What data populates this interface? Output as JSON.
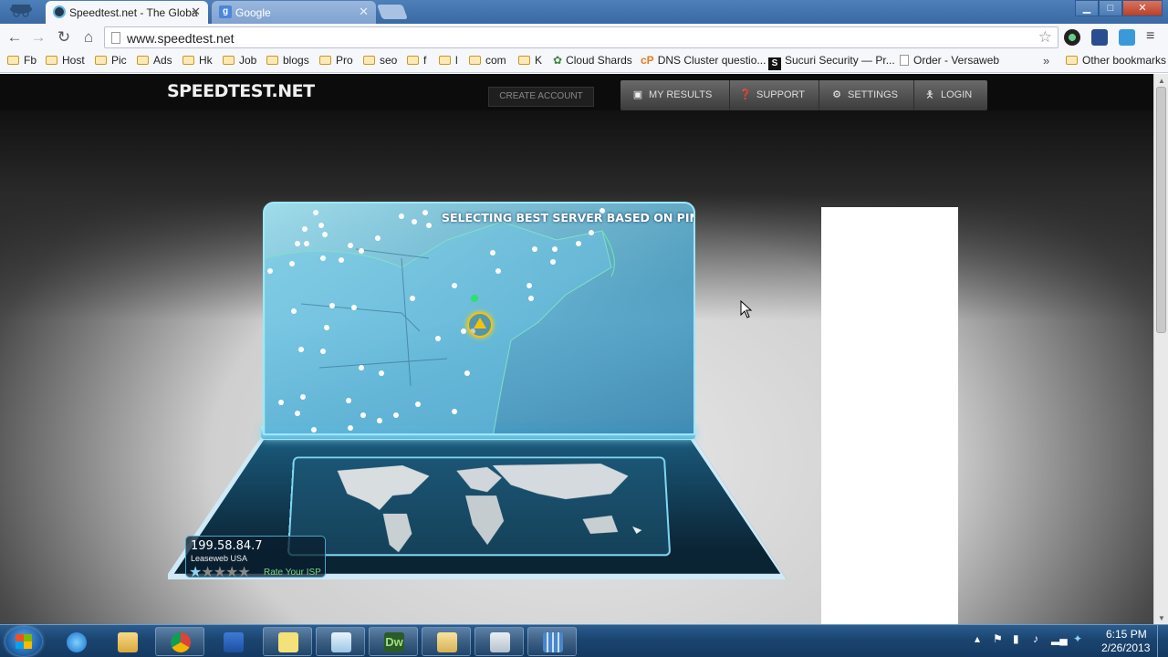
{
  "browser": {
    "tabs": [
      {
        "label": "Speedtest.net - The Globa",
        "active": true,
        "favicon": "speedtest-icon"
      },
      {
        "label": "Google",
        "active": false,
        "favicon": "google-icon"
      }
    ],
    "url": "www.speedtest.net",
    "window_controls": {
      "minimize": "▁",
      "maximize": "□",
      "close": "✕"
    },
    "bookmarks": [
      {
        "label": "Fb",
        "icon": "folder-icon"
      },
      {
        "label": "Host",
        "icon": "folder-icon"
      },
      {
        "label": "Pic",
        "icon": "folder-icon"
      },
      {
        "label": "Ads",
        "icon": "folder-icon"
      },
      {
        "label": "Hk",
        "icon": "folder-icon"
      },
      {
        "label": "Job",
        "icon": "folder-icon"
      },
      {
        "label": "blogs",
        "icon": "folder-icon"
      },
      {
        "label": "Pro",
        "icon": "folder-icon"
      },
      {
        "label": "seo",
        "icon": "folder-icon"
      },
      {
        "label": "f",
        "icon": "folder-icon"
      },
      {
        "label": "l",
        "icon": "folder-icon"
      },
      {
        "label": "com",
        "icon": "folder-icon"
      },
      {
        "label": "K",
        "icon": "folder-icon"
      },
      {
        "label": "Cloud Shards",
        "icon": "cloudshards-icon"
      },
      {
        "label": "DNS Cluster questio...",
        "icon": "cpanel-icon"
      },
      {
        "label": "Sucuri Security — Pr...",
        "icon": "sucuri-icon"
      },
      {
        "label": "Order - Versaweb",
        "icon": "page-icon"
      }
    ],
    "bookmarks_more": "»",
    "other_bookmarks": "Other bookmarks"
  },
  "speedtest": {
    "logo": "SPEEDTEST.NET",
    "create_account": "CREATE ACCOUNT",
    "nav": [
      {
        "label": "MY RESULTS",
        "icon": "camera-icon"
      },
      {
        "label": "SUPPORT",
        "icon": "question-icon"
      },
      {
        "label": "SETTINGS",
        "icon": "gear-icon"
      },
      {
        "label": "LOGIN",
        "icon": "person-icon"
      }
    ],
    "status": "SELECTING BEST SERVER BASED ON PING",
    "isp": {
      "ip": "199.58.84.7",
      "name": "Leaseweb USA",
      "rating": 1,
      "max_rating": 5,
      "rate_label": "Rate Your ISP"
    }
  },
  "taskbar": {
    "pinned": [
      "ie-icon",
      "explorer-icon",
      "chrome-icon",
      "outlook-icon",
      "sticky-notes-icon",
      "notes-icon",
      "dreamweaver-icon",
      "folder-doc-icon",
      "calculator-icon",
      "movie-maker-icon"
    ],
    "dreamweaver_label": "Dw",
    "clock_time": "6:15 PM",
    "clock_date": "2/26/2013"
  },
  "colors": {
    "accent_blue": "#9fe6ff",
    "server_marker": "#f5c400",
    "rate_isp_green": "#7dd87d"
  }
}
